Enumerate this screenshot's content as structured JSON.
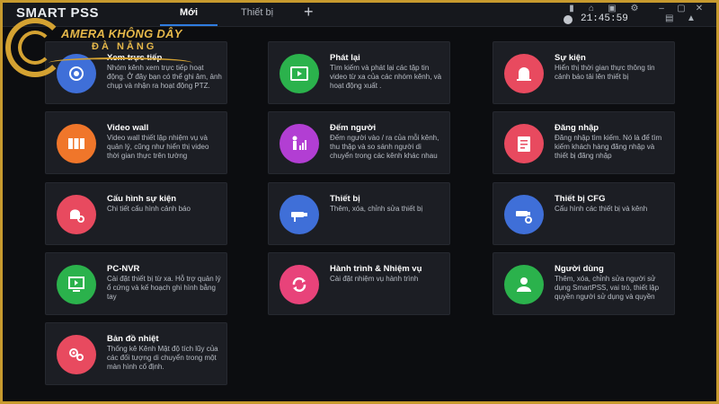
{
  "app": {
    "title": "SMART PSS"
  },
  "tabs": [
    {
      "label": "Mới",
      "active": true
    },
    {
      "label": "Thiết bị",
      "active": false
    }
  ],
  "tab_add_symbol": "+",
  "status": {
    "time": "21:45:59"
  },
  "logo": {
    "line1": "AMERA KHÔNG DÂY",
    "line2": "ĐÀ NẴNG"
  },
  "cards": [
    {
      "title": "Xem trực tiếp",
      "desc": "Nhóm kênh xem trực tiếp hoạt động. Ở đây bạn có thể ghi âm, ảnh chụp và nhận ra hoạt động PTZ.",
      "icon": "live-view-icon",
      "color": "#3f6fd8"
    },
    {
      "title": "Phát lại",
      "desc": "Tìm kiếm và phát lại các tập tin video từ xa của các nhóm kênh, và hoạt động xuất .",
      "icon": "playback-icon",
      "color": "#2bb24c"
    },
    {
      "title": "Sự kiện",
      "desc": "Hiển thị thời gian thực thông tin cảnh báo tải lên thiết bị",
      "icon": "alarm-icon",
      "color": "#e84a5f"
    },
    {
      "title": "Video wall",
      "desc": "Video wall thiết lập nhiệm vụ và quản lý, cũng như hiển thị video thời gian thực trên tường",
      "icon": "video-wall-icon",
      "color": "#f0762a"
    },
    {
      "title": "Đếm người",
      "desc": "Đếm người vào / ra của mỗi kênh, thu thập và so sánh người di chuyển trong các kênh khác nhau",
      "icon": "people-count-icon",
      "color": "#b23ed3"
    },
    {
      "title": "Đăng nhập",
      "desc": "Đăng nhập tìm kiếm. Nó là để tìm kiếm khách hàng đăng nhập và thiết bị đăng nhập",
      "icon": "log-icon",
      "color": "#e84a5f"
    },
    {
      "title": "Cấu hình sự kiện",
      "desc": "Chi tiết cấu hình cảnh báo",
      "icon": "event-config-icon",
      "color": "#e84a5f"
    },
    {
      "title": "Thiết bị",
      "desc": "Thêm, xóa, chỉnh sửa thiết bị",
      "icon": "device-icon",
      "color": "#3f6fd8"
    },
    {
      "title": "Thiết bị CFG",
      "desc": "Cấu hình các thiết bị và kênh",
      "icon": "device-cfg-icon",
      "color": "#3f6fd8"
    },
    {
      "title": "PC-NVR",
      "desc": "Cài đặt thiết bị từ xa. Hỗ trợ quản lý ổ cứng và kế hoạch ghi hình bằng tay",
      "icon": "pc-nvr-icon",
      "color": "#2bb24c"
    },
    {
      "title": "Hành trình & Nhiệm vụ",
      "desc": "Cài đặt nhiệm vụ hành trình",
      "icon": "tour-icon",
      "color": "#e8437a"
    },
    {
      "title": "Người dùng",
      "desc": "Thêm, xóa, chỉnh sửa người sử dụng SmartPSS, vai trò, thiết lập quyền người sử dụng và quyền",
      "icon": "user-icon",
      "color": "#2bb24c"
    },
    {
      "title": "Bản đồ nhiệt",
      "desc": "Thống kê Kênh Mật độ tích lũy của các đối tượng di chuyển trong một màn hình cố định.",
      "icon": "heatmap-icon",
      "color": "#e84a5f"
    }
  ]
}
